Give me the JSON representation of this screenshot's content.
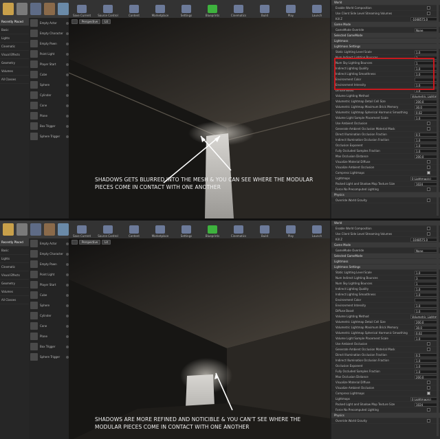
{
  "mode_icons": [
    "place-mode-icon",
    "paint-mode-icon",
    "landscape-mode-icon",
    "foliage-mode-icon",
    "geometry-mode-icon"
  ],
  "toolbar": [
    "Save Current",
    "Source Control",
    "Content",
    "Marketplace",
    "Settings",
    "Blueprints",
    "Cinematics",
    "Build",
    "Play",
    "Launch"
  ],
  "place_categories": [
    "Recently Placed",
    "Basic",
    "Lights",
    "Cinematic",
    "Visual Effects",
    "Geometry",
    "Volumes",
    "All Classes"
  ],
  "actors": [
    "Empty Actor",
    "Empty Character",
    "Empty Pawn",
    "Point Light",
    "Player Start",
    "Cube",
    "Sphere",
    "Cylinder",
    "Cone",
    "Plane",
    "Box Trigger",
    "Sphere Trigger"
  ],
  "viewport_buttons": {
    "perspective": "Perspective",
    "lit": "Lit"
  },
  "details": [
    {
      "label": "World",
      "section": true
    },
    {
      "label": "Enable World Composition",
      "check": false
    },
    {
      "label": "Use Client Side Level Streaming Volumes",
      "check": false
    },
    {
      "label": "Kill Z",
      "value": "-1048575.0"
    },
    {
      "label": "Game Mode",
      "section": true
    },
    {
      "label": "GameMode Override",
      "value": "None"
    },
    {
      "label": "Selected GameMode",
      "section": true
    },
    {
      "label": "Lightmass",
      "section": true
    },
    {
      "label": "Lightmass Settings",
      "section": true
    },
    {
      "label": "Static Lighting Level Scale",
      "value": "1.0"
    },
    {
      "label": "Num Indirect Lighting Bounces",
      "value": "3"
    },
    {
      "label": "Num Sky Lighting Bounces",
      "value": "1"
    },
    {
      "label": "Indirect Lighting Quality",
      "value": "1.0"
    },
    {
      "label": "Indirect Lighting Smoothness",
      "value": "1.0"
    },
    {
      "label": "Environment Color",
      "value": ""
    },
    {
      "label": "Environment Intensity",
      "value": "1.0"
    },
    {
      "label": "Diffuse Boost",
      "value": "1.0"
    },
    {
      "label": "Volume Lighting Method",
      "value": "Volumetric Lightmap"
    },
    {
      "label": "Volumetric Lightmap Detail Cell Size",
      "value": "200.0"
    },
    {
      "label": "Volumetric Lightmap Maximum Brick Memory",
      "value": "30.0"
    },
    {
      "label": "Volumetric Lightmap Spherical Harmonic Smoothing",
      "value": "0.02"
    },
    {
      "label": "Volume Light Sample Placement Scale",
      "value": "1.0"
    },
    {
      "label": "Use Ambient Occlusion",
      "check": false
    },
    {
      "label": "Generate Ambient Occlusion Material Mask",
      "check": false
    },
    {
      "label": "Direct Illumination Occlusion Fraction",
      "value": "0.5"
    },
    {
      "label": "Indirect Illumination Occlusion Fraction",
      "value": "1.0"
    },
    {
      "label": "Occlusion Exponent",
      "value": "1.0"
    },
    {
      "label": "Fully Occluded Samples Fraction",
      "value": "1.0"
    },
    {
      "label": "Max Occlusion Distance",
      "value": "200.0"
    },
    {
      "label": "Visualize Material Diffuse",
      "check": false
    },
    {
      "label": "Visualize Ambient Occlusion",
      "check": false
    },
    {
      "label": "Compress Lightmaps",
      "check": true
    },
    {
      "label": "Lightmaps",
      "value": "0 Lightmap(s)"
    },
    {
      "label": "Packed Light and Shadow Map Texture Size",
      "value": "1024"
    },
    {
      "label": "Force No Precomputed Lighting",
      "check": false
    },
    {
      "label": "Physics",
      "section": true
    },
    {
      "label": "Override World Gravity",
      "check": false
    }
  ],
  "captions": {
    "top_line1": "SHADOWS GETS BLURRED INTO THE MESH & YOU CAN SEE WHERE THE MODULAR",
    "top_line2": "PIECES COME IN CONTACT WITH ONE ANOTHER",
    "bottom_line1": "SHADOWS ARE MORE REFINED AND NOTICIBLE & YOU CAN'T SEE WHERE THE",
    "bottom_line2": "MODULAR PIECES COME IN CONTACT WITH ONE ANOTHER"
  },
  "colors": {
    "highlight": "#c8191e",
    "build_icon": "#3eb23e"
  }
}
